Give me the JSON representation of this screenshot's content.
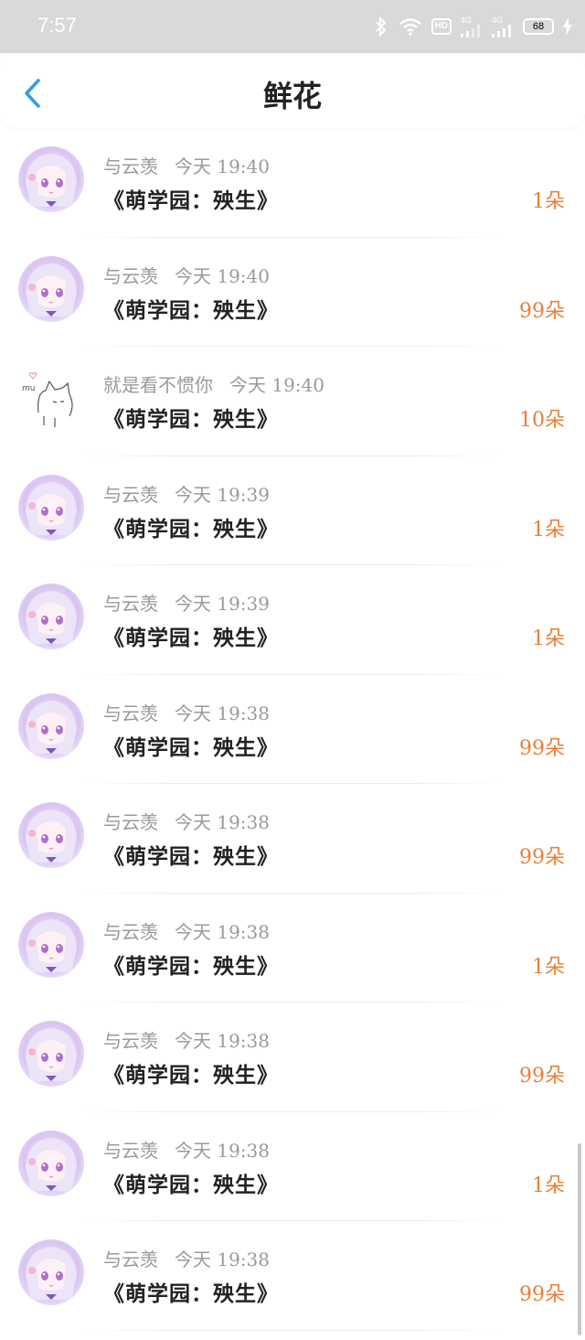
{
  "status_bar": {
    "time": "7:57",
    "network_1": "4G",
    "network_2": "4G",
    "hd": "HD",
    "battery": "68"
  },
  "header": {
    "title": "鲜花"
  },
  "colors": {
    "amount": "#e8803a",
    "meta": "#9a9a9a",
    "accent": "#2a9df4"
  },
  "rows": [
    {
      "user": "与云羡",
      "day": "今天",
      "time": "19:40",
      "book": "《萌学园：殃生》",
      "amount": "1朵",
      "avatar": "anime-girl"
    },
    {
      "user": "与云羡",
      "day": "今天",
      "time": "19:40",
      "book": "《萌学园：殃生》",
      "amount": "99朵",
      "avatar": "anime-girl"
    },
    {
      "user": "就是看不惯你",
      "day": "今天",
      "time": "19:40",
      "book": "《萌学园：殃生》",
      "amount": "10朵",
      "avatar": "cat-sketch"
    },
    {
      "user": "与云羡",
      "day": "今天",
      "time": "19:39",
      "book": "《萌学园：殃生》",
      "amount": "1朵",
      "avatar": "anime-girl"
    },
    {
      "user": "与云羡",
      "day": "今天",
      "time": "19:39",
      "book": "《萌学园：殃生》",
      "amount": "1朵",
      "avatar": "anime-girl"
    },
    {
      "user": "与云羡",
      "day": "今天",
      "time": "19:38",
      "book": "《萌学园：殃生》",
      "amount": "99朵",
      "avatar": "anime-girl"
    },
    {
      "user": "与云羡",
      "day": "今天",
      "time": "19:38",
      "book": "《萌学园：殃生》",
      "amount": "99朵",
      "avatar": "anime-girl"
    },
    {
      "user": "与云羡",
      "day": "今天",
      "time": "19:38",
      "book": "《萌学园：殃生》",
      "amount": "1朵",
      "avatar": "anime-girl"
    },
    {
      "user": "与云羡",
      "day": "今天",
      "time": "19:38",
      "book": "《萌学园：殃生》",
      "amount": "99朵",
      "avatar": "anime-girl"
    },
    {
      "user": "与云羡",
      "day": "今天",
      "time": "19:38",
      "book": "《萌学园：殃生》",
      "amount": "1朵",
      "avatar": "anime-girl"
    },
    {
      "user": "与云羡",
      "day": "今天",
      "time": "19:38",
      "book": "《萌学园：殃生》",
      "amount": "99朵",
      "avatar": "anime-girl"
    }
  ],
  "avatar_sketch_text": "mu"
}
